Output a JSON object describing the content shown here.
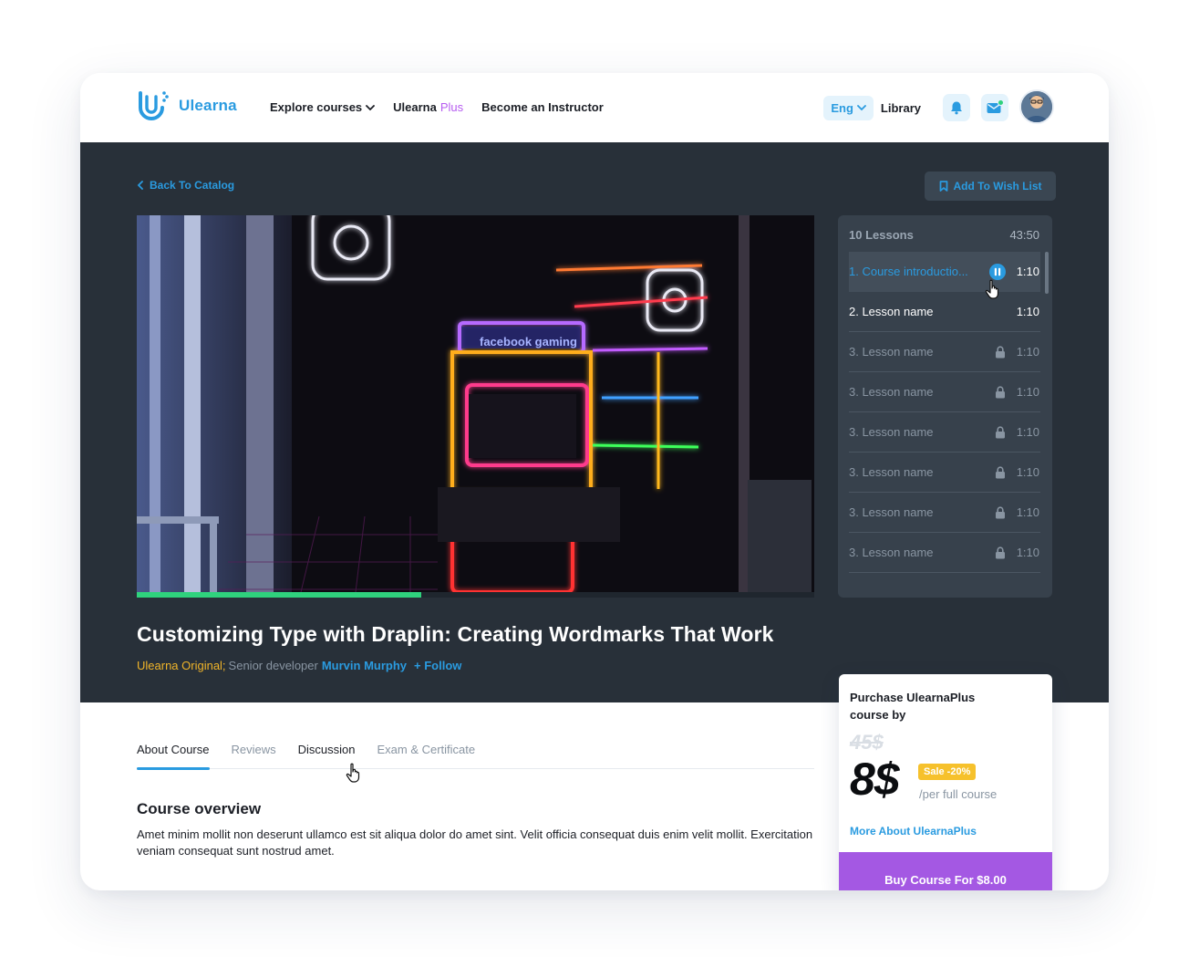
{
  "brand": {
    "name": "Ulearna",
    "color": "#2a9be0"
  },
  "nav": {
    "explore": "Explore courses",
    "plus_a": "Ulearna",
    "plus_b": "Plus",
    "instructor": "Become an Instructor"
  },
  "header": {
    "lang": "Eng",
    "library": "Library"
  },
  "hero": {
    "back": "Back To Catalog",
    "wishlist": "Add To Wish List",
    "video_text": "facebook gaming",
    "progress": 0.42
  },
  "lessons": {
    "count_label": "10 Lessons",
    "total": "43:50",
    "items": [
      {
        "name": "1. Course introductio...",
        "duration": "1:10",
        "state": "playing"
      },
      {
        "name": "2. Lesson name",
        "duration": "1:10",
        "state": "unlocked"
      },
      {
        "name": "3. Lesson name",
        "duration": "1:10",
        "state": "locked"
      },
      {
        "name": "3. Lesson name",
        "duration": "1:10",
        "state": "locked"
      },
      {
        "name": "3. Lesson name",
        "duration": "1:10",
        "state": "locked"
      },
      {
        "name": "3. Lesson name",
        "duration": "1:10",
        "state": "locked"
      },
      {
        "name": "3. Lesson name",
        "duration": "1:10",
        "state": "locked"
      },
      {
        "name": "3. Lesson name",
        "duration": "1:10",
        "state": "locked"
      }
    ]
  },
  "course": {
    "title": "Customizing Type with Draplin: Creating Wordmarks That Work",
    "original": "Ulearna Original;",
    "role": "Senior developer",
    "author": "Murvin Murphy",
    "follow": "Follow"
  },
  "tabs": [
    "About Course",
    "Reviews",
    "Discussion",
    "Exam & Certificate"
  ],
  "overview": {
    "title": "Course overview",
    "text": "Amet minim mollit non deserunt ullamco est sit aliqua dolor do amet sint. Velit officia consequat duis enim velit mollit. Exercitation veniam consequat sunt nostrud amet."
  },
  "purchase": {
    "title": "Purchase UlearnaPlus course by",
    "old_price": "45$",
    "price": "8$",
    "sale": "Sale -20%",
    "per": "/per full course",
    "more": "More About UlearnaPlus",
    "buy": "Buy Course For $8.00"
  },
  "colors": {
    "accent": "#2a9be0",
    "plus": "#b65cf0",
    "hero_bg": "#283039",
    "progress": "#2fd27d",
    "buy": "#a458e3",
    "sale": "#f6c12c",
    "original": "#f0b429"
  }
}
